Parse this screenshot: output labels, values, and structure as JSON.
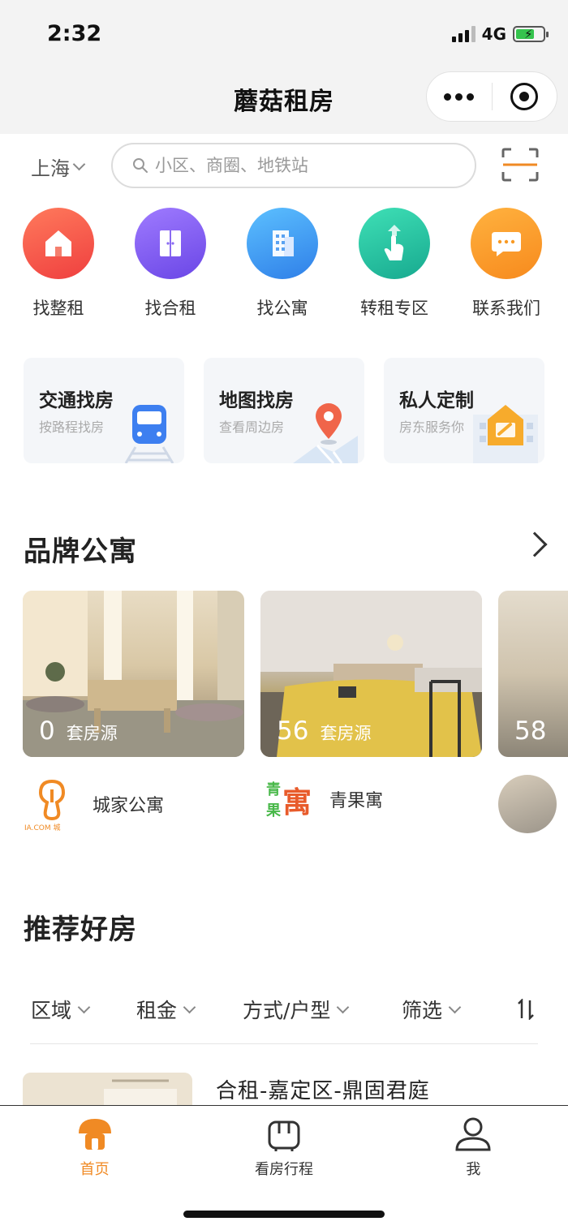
{
  "status_bar": {
    "time": "2:32",
    "network": "4G"
  },
  "header": {
    "title": "蘑菇租房"
  },
  "search": {
    "city": "上海",
    "placeholder": "小区、商圈、地铁站"
  },
  "categories": [
    {
      "label": "找整租",
      "icon": "house-icon",
      "color": "#f35a47"
    },
    {
      "label": "找合租",
      "icon": "door-icon",
      "color": "#7c5ff0"
    },
    {
      "label": "找公寓",
      "icon": "building-icon",
      "color": "#3d93f0"
    },
    {
      "label": "转租专区",
      "icon": "hand-pointer-icon",
      "color": "#2fc8a6"
    },
    {
      "label": "联系我们",
      "icon": "chat-bubble-icon",
      "color": "#f89a24"
    }
  ],
  "quick_cards": [
    {
      "title": "交通找房",
      "subtitle": "按路程找房"
    },
    {
      "title": "地图找房",
      "subtitle": "查看周边房"
    },
    {
      "title": "私人定制",
      "subtitle": "房东服务你"
    }
  ],
  "brand_section": {
    "title": "品牌公寓",
    "items": [
      {
        "count": "0",
        "unit": "套房源",
        "name": "城家公寓",
        "logo_text": "IA.COM 城"
      },
      {
        "count": "56",
        "unit": "套房源",
        "name": "青果寓",
        "logo_text": "青果寓"
      },
      {
        "count": "58",
        "unit": "",
        "name": ""
      }
    ]
  },
  "recommend_section": {
    "title": "推荐好房",
    "filters": [
      "区域",
      "租金",
      "方式/户型",
      "筛选"
    ],
    "sort_icon": "sort-icon",
    "first_listing_title": "合租-嘉定区-鼎固君庭"
  },
  "tabbar": [
    {
      "label": "首页",
      "active": true
    },
    {
      "label": "看房行程",
      "active": false
    },
    {
      "label": "我",
      "active": false
    }
  ],
  "colors": {
    "accent": "#f08a24"
  }
}
